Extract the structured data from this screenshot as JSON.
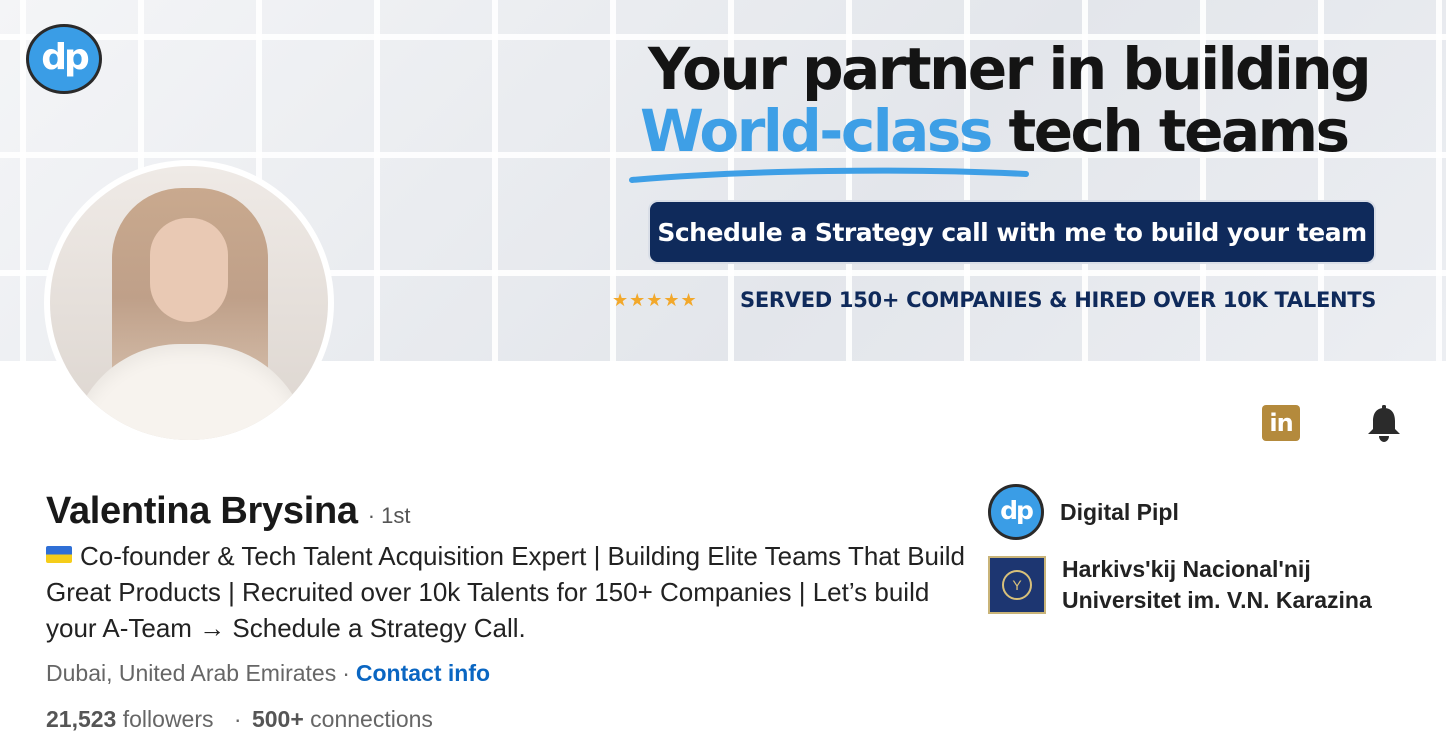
{
  "banner": {
    "logo_text": "dp",
    "headline_line1": "Your partner in building",
    "headline_accent": "World-class",
    "headline_rest": " tech teams",
    "cta_label": "Schedule a Strategy call with me to build your team",
    "stars": "★★★★★",
    "served_text": "SERVED 150+ COMPANIES & HIRED OVER 10K TALENTS",
    "accent_color": "#3e9fe6",
    "navy_color": "#0f2a5b"
  },
  "actions": {
    "linkedin_icon_text": "in",
    "linkedin_icon_name": "linkedin-icon",
    "bell_icon_name": "bell-icon"
  },
  "profile": {
    "name": "Valentina Brysina",
    "degree": "· 1st",
    "headline": "Co-founder & Tech Talent Acquisition Expert | Building Elite Teams That Build Great Products | Recruited over 10k Talents for 150+ Companies | Let’s build your A-Team → Schedule a Strategy Call.",
    "location": "Dubai, United Arab Emirates",
    "location_sep": "·",
    "contact_info": "Contact info",
    "followers_count": "21,523",
    "followers_label": "followers",
    "stats_sep": "·",
    "connections_count": "500+",
    "connections_label": "connections"
  },
  "organizations": [
    {
      "name": "Digital Pipl",
      "logo_text": "dp"
    },
    {
      "name": "Harkivs'kij Nacional'nij Universitet im. V.N. Karazina",
      "logo_text": "Y"
    }
  ],
  "colors": {
    "link": "#0a66c2",
    "linkedin_brand_muted": "#b48a3c"
  }
}
